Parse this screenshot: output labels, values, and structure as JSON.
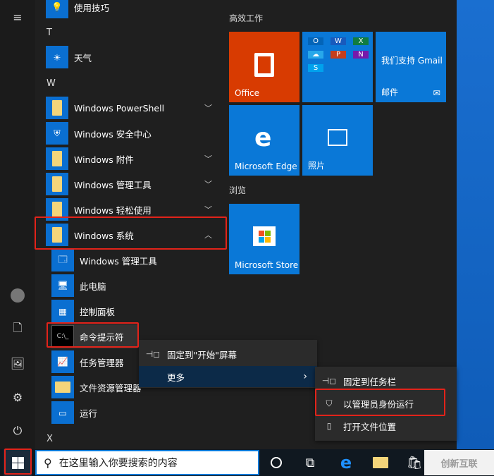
{
  "app_list": {
    "items": [
      {
        "label": "使用技巧",
        "icon": "lightbulb-icon"
      },
      {
        "header": "T"
      },
      {
        "label": "天气",
        "icon": "sun-icon"
      },
      {
        "header": "W"
      },
      {
        "label": "Windows PowerShell",
        "icon": "folder-icon",
        "expandable": true
      },
      {
        "label": "Windows 安全中心",
        "icon": "shield-icon"
      },
      {
        "label": "Windows 附件",
        "icon": "folder-icon",
        "expandable": true
      },
      {
        "label": "Windows 管理工具",
        "icon": "folder-icon",
        "expandable": true
      },
      {
        "label": "Windows 轻松使用",
        "icon": "folder-icon",
        "expandable": true
      },
      {
        "label": "Windows 系统",
        "icon": "folder-icon",
        "expanded": true
      }
    ],
    "system_items": [
      "Windows 管理工具",
      "此电脑",
      "控制面板",
      "命令提示符",
      "任务管理器",
      "文件资源管理器",
      "运行"
    ],
    "header_x": "X"
  },
  "tiles": {
    "group1": "高效工作",
    "office": "Office",
    "gmail_title": "我们支持 Gmail",
    "mail": "邮件",
    "edge": "Microsoft Edge",
    "photos": "照片",
    "group2": "浏览",
    "store": "Microsoft Store"
  },
  "context_menu": {
    "pin_start": "固定到\"开始\"屏幕",
    "more": "更多"
  },
  "submenu": {
    "pin_taskbar": "固定到任务栏",
    "run_admin": "以管理员身份运行",
    "open_location": "打开文件位置"
  },
  "taskbar": {
    "search_placeholder": "在这里输入你要搜索的内容"
  },
  "watermark": "创新互联",
  "colors": {
    "accent": "#0a78d7",
    "highlight_box": "#e2231a",
    "office": "#d83b01"
  }
}
